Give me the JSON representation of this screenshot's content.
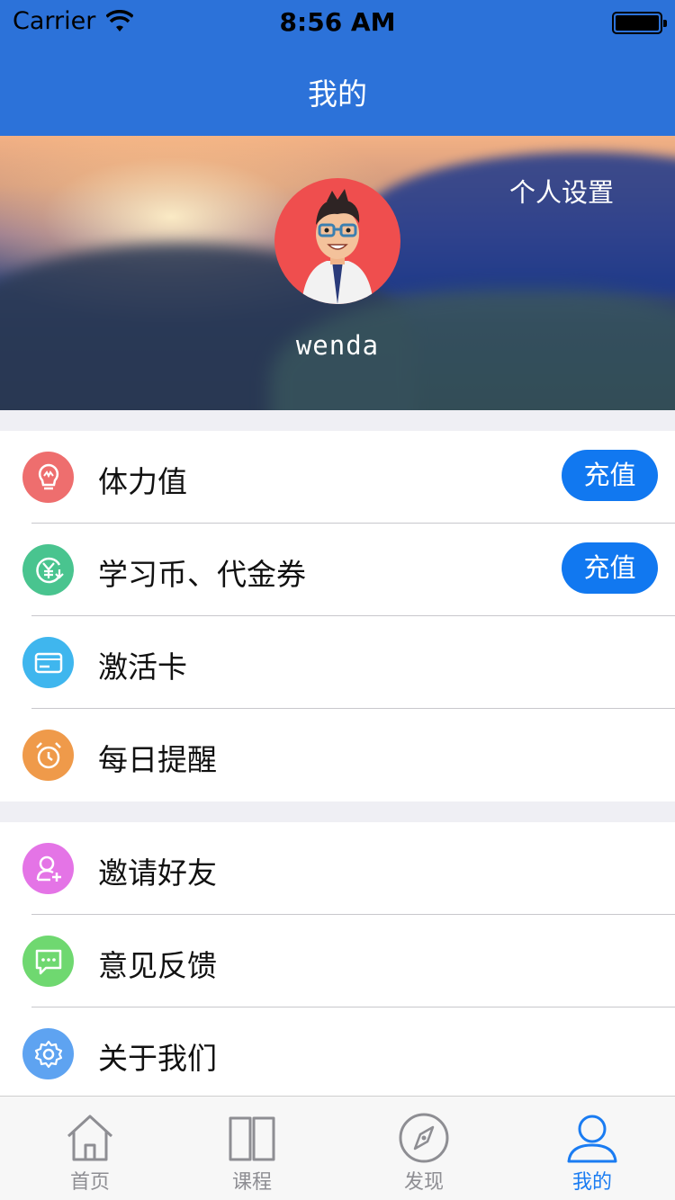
{
  "status_bar": {
    "carrier": "Carrier",
    "time": "8:56 AM"
  },
  "nav": {
    "title": "我的"
  },
  "profile": {
    "settings_link": "个人设置",
    "username": "wenda"
  },
  "menu_group_1": [
    {
      "label": "体力值",
      "icon": "lightbulb-icon",
      "color": "#ee6e6e",
      "action": "充值"
    },
    {
      "label": "学习币、代金券",
      "icon": "yuan-coin-icon",
      "color": "#49c48f",
      "action": "充值"
    },
    {
      "label": "激活卡",
      "icon": "card-icon",
      "color": "#3fb6ee"
    },
    {
      "label": "每日提醒",
      "icon": "alarm-clock-icon",
      "color": "#ef9a4a"
    }
  ],
  "menu_group_2": [
    {
      "label": "邀请好友",
      "icon": "add-friend-icon",
      "color": "#e474e6"
    },
    {
      "label": "意见反馈",
      "icon": "message-icon",
      "color": "#6fd870"
    },
    {
      "label": "关于我们",
      "icon": "gear-icon",
      "color": "#5ea3f1"
    }
  ],
  "tab_bar": [
    {
      "label": "首页",
      "icon": "home-icon"
    },
    {
      "label": "课程",
      "icon": "book-icon"
    },
    {
      "label": "发现",
      "icon": "compass-icon"
    },
    {
      "label": "我的",
      "icon": "person-icon",
      "active": true
    }
  ],
  "colors": {
    "nav_blue": "#2c72d9",
    "button_blue": "#1178f0",
    "active_tab": "#1a7cf2"
  }
}
